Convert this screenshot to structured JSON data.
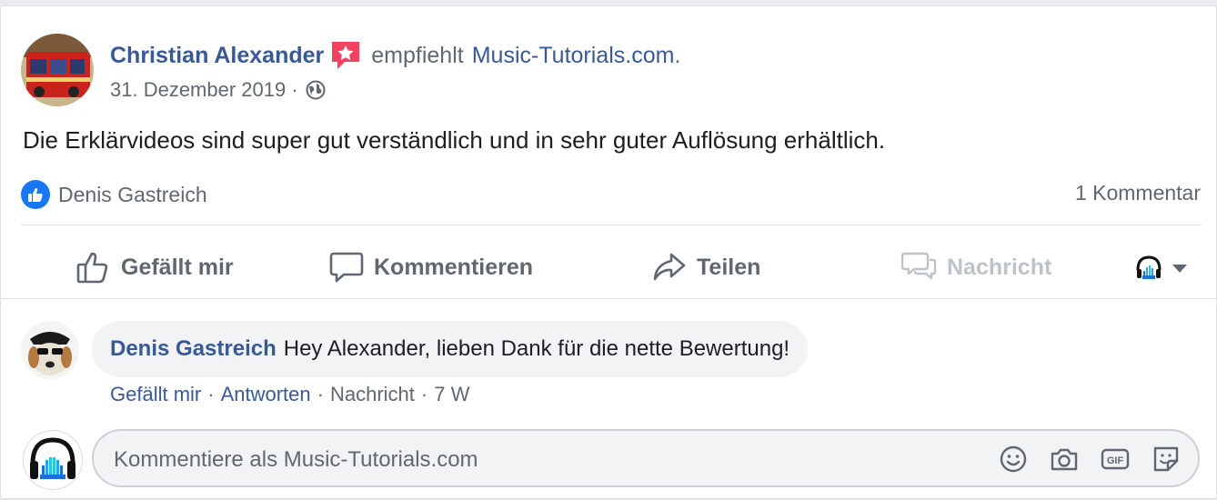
{
  "post": {
    "author": "Christian Alexander",
    "action_text": "empfiehlt",
    "page_name": "Music-Tutorials.com",
    "page_suffix": ".",
    "date": "31. Dezember 2019",
    "date_sep": "·",
    "privacy_icon": "globe-icon",
    "text": "Die Erklärvideos sind super gut verständlich und in sehr guter Auflösung erhältlich.",
    "reactions": {
      "icon": "like-badge-icon",
      "names": "Denis Gastreich"
    },
    "comment_count": "1 Kommentar"
  },
  "actions": {
    "like": "Gefällt mir",
    "comment": "Kommentieren",
    "share": "Teilen",
    "message": "Nachricht"
  },
  "comment": {
    "author": "Denis Gastreich",
    "text": "Hey Alexander, lieben Dank für die nette Bewertung!",
    "like": "Gefällt mir",
    "reply": "Antworten",
    "message": "Nachricht",
    "time": "7 W",
    "sep": "·"
  },
  "composer": {
    "placeholder": "Kommentiere als Music-Tutorials.com",
    "icons": [
      "emoji-icon",
      "camera-icon",
      "gif-icon",
      "sticker-icon"
    ]
  },
  "colors": {
    "link": "#385898",
    "secondary_text": "#606770",
    "accent_blue": "#1877f2",
    "recommend_badge": "#f3425f"
  }
}
